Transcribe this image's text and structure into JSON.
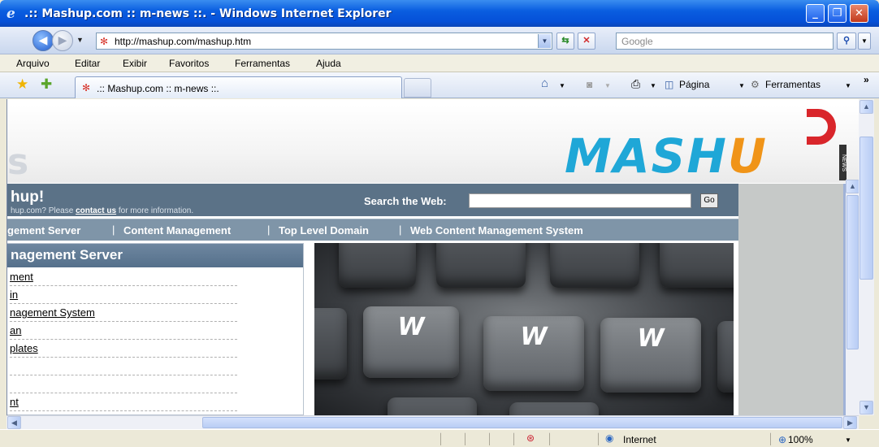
{
  "window": {
    "title": ".:: Mashup.com :: m-news ::. - Windows Internet Explorer",
    "min_label": "_",
    "max_label": "❐",
    "close_label": "✕"
  },
  "address": {
    "url": "http://mashup.com/mashup.htm",
    "search_placeholder": "Google"
  },
  "menu": {
    "items": [
      "Arquivo",
      "Editar",
      "Exibir",
      "Favoritos",
      "Ferramentas",
      "Ajuda"
    ]
  },
  "tabs": {
    "active_label": ".:: Mashup.com :: m-news ::."
  },
  "toolbar": {
    "page_label": "Página",
    "tools_label": "Ferramentas",
    "overflow_label": "»"
  },
  "page": {
    "ghost_text": "s",
    "logo": {
      "main": "MASH",
      "u": "U"
    },
    "logo_badge": "NEWS",
    "heading": "hup!",
    "sub_prefix": "hup.com? Please ",
    "sub_link": "contact us",
    "sub_suffix": " for more information.",
    "search_label": "Search the Web:",
    "go_label": "Go",
    "nav": [
      "gement Server",
      "Content Management",
      "Top Level Domain",
      "Web Content Management System"
    ],
    "box_title": "nagement Server",
    "box_items": [
      "ment",
      "in",
      "nagement System",
      "an",
      "plates",
      "",
      "",
      "nt"
    ],
    "keys": [
      "W",
      "W",
      "W"
    ]
  },
  "status": {
    "zone": "Internet",
    "zoom": "100%"
  }
}
